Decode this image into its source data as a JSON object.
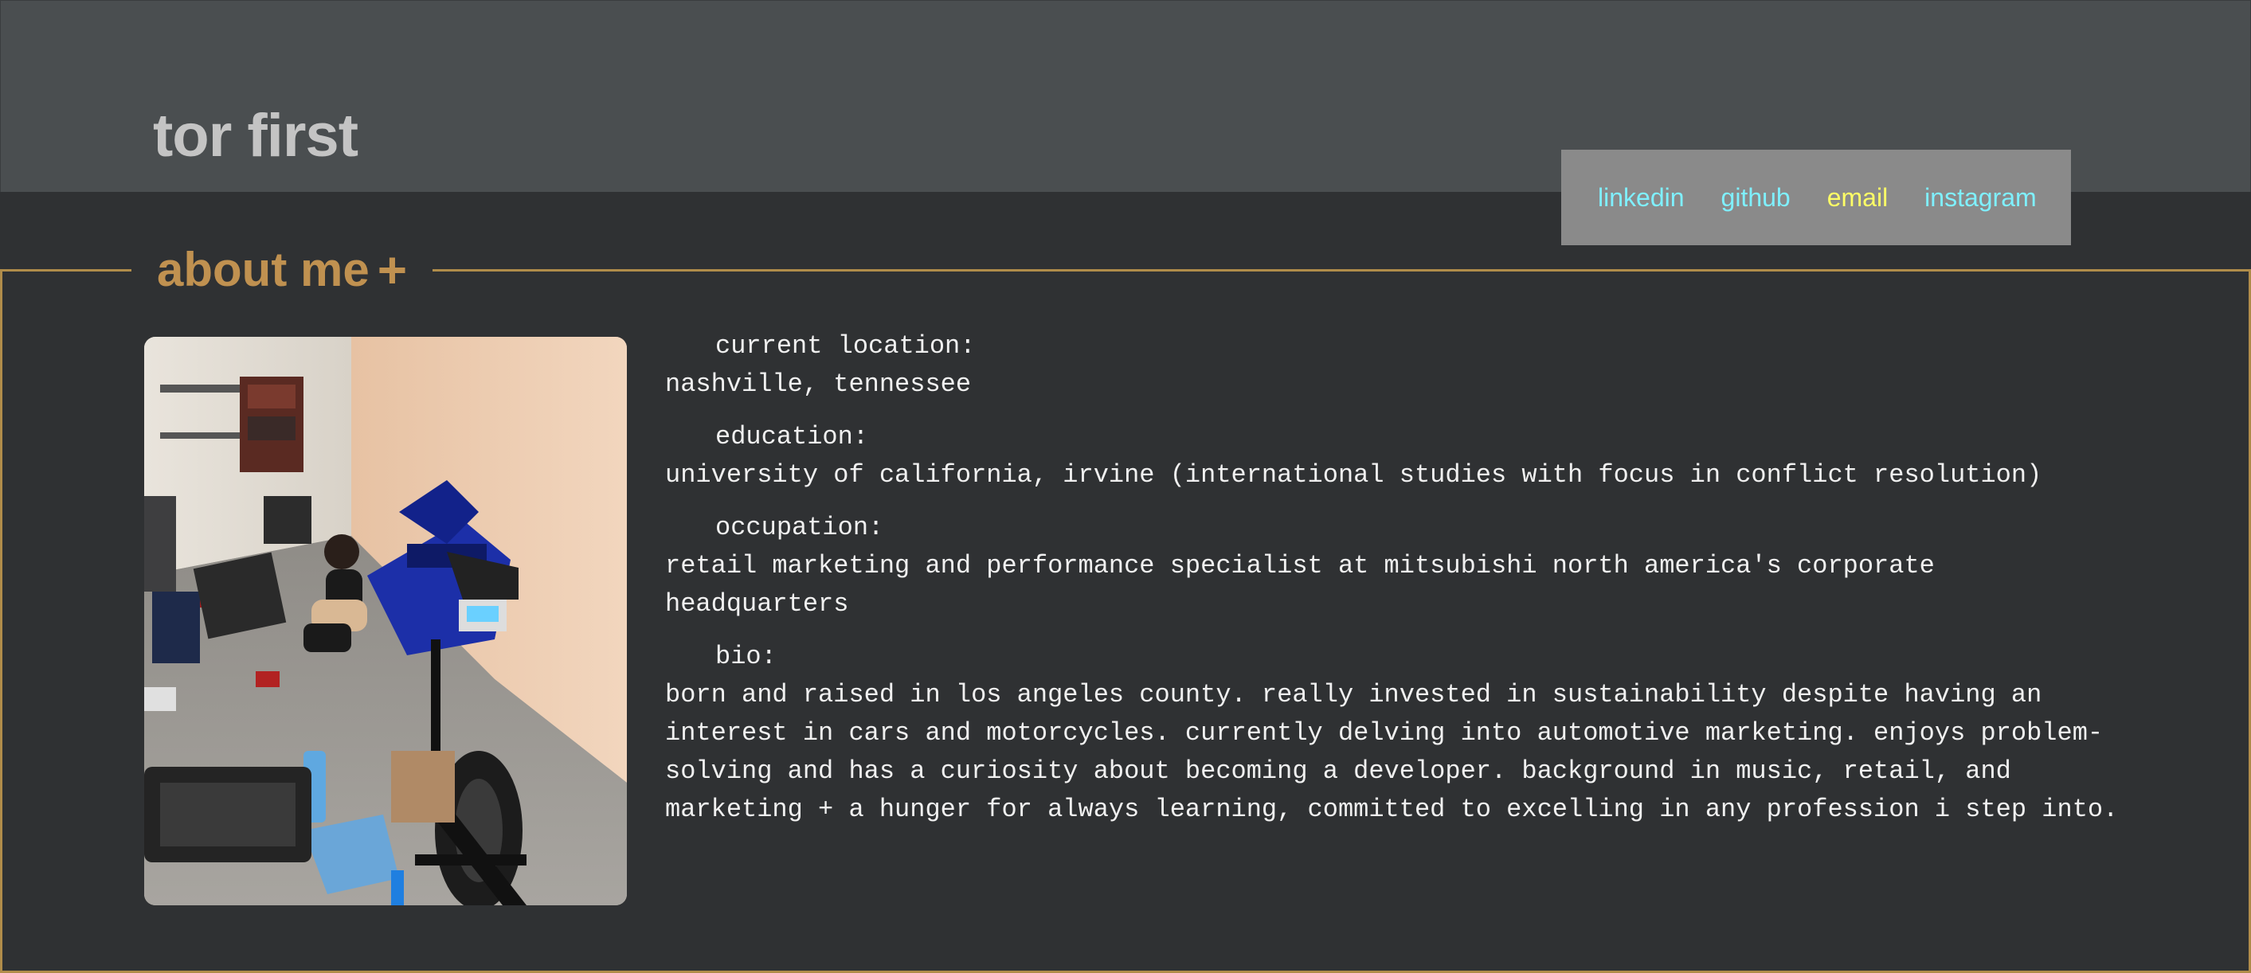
{
  "header": {
    "title": "tor first"
  },
  "nav": {
    "links": [
      {
        "label": "linkedin",
        "color": "#7ff0ff"
      },
      {
        "label": "github",
        "color": "#7ff0ff"
      },
      {
        "label": "email",
        "color": "#ffff66"
      },
      {
        "label": "instagram",
        "color": "#7ff0ff"
      }
    ]
  },
  "about": {
    "heading": "about me",
    "toggle_symbol": "+",
    "photo_alt": "person working on a blue motorcycle in a garage",
    "fields": [
      {
        "label": "current location:",
        "value": "nashville, tennessee"
      },
      {
        "label": "education:",
        "value": "university of california, irvine (international studies with focus in conflict resolution)"
      },
      {
        "label": "occupation:",
        "value": "retail marketing and performance specialist at mitsubishi north america's corporate headquarters"
      },
      {
        "label": "bio:",
        "value": "born and raised in los angeles county. really invested in sustainability despite having an interest in cars and motorcycles. currently delving into automotive marketing. enjoys problem-solving and has a curiosity about becoming a developer. background in music, retail, and marketing + a hunger for always learning, committed to excelling in any profession i step into."
      }
    ]
  },
  "colors": {
    "header_bg": "#4a4e50",
    "page_bg": "#2f3133",
    "accent": "#c09150",
    "nav_bg": "#8a8a8a"
  }
}
